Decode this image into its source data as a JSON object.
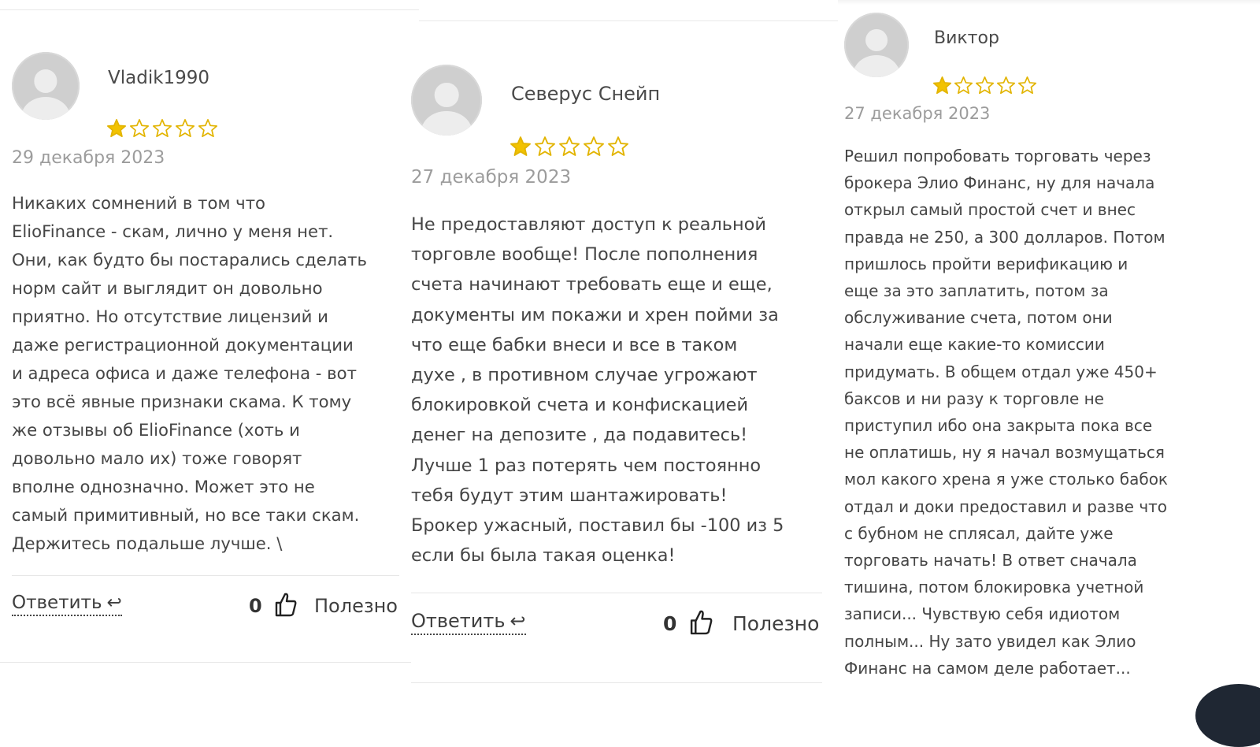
{
  "colors": {
    "star_filled": "#f2c200",
    "star_empty_stroke": "#e2b400",
    "date": "#9c9c9c",
    "text": "#454545"
  },
  "icons": {
    "avatar": "default-user-avatar",
    "star": "star-icon",
    "reply": "reply-arrow-icon",
    "like": "thumbs-up-icon"
  },
  "reviews": [
    {
      "author": "Vladik1990",
      "rating": 1,
      "max_rating": 5,
      "date": "29 декабря 2023",
      "lines": [
        "Никаких сомнений в том что",
        "ElioFinance - скам, лично у меня нет.",
        "Они, как будто бы постарались сделать",
        "норм сайт и выглядит он довольно",
        "приятно. Но отсутствие лицензий и",
        "даже регистрационной документации",
        "и адреса офиса и даже телефона - вот",
        "это всё явные признаки скама. К тому",
        "же отзывы об ElioFinance (хоть и",
        "довольно мало их) тоже говорят",
        "вполне однозначно. Может это не",
        "самый примитивный, но все таки скам.",
        "Держитесь подальше лучше. \\"
      ],
      "reply_label": "Ответить",
      "reply_arrow": "↩",
      "likes": "0",
      "useful_label": "Полезно"
    },
    {
      "author": "Северус Снейп",
      "rating": 1,
      "max_rating": 5,
      "date": "27 декабря 2023",
      "lines": [
        "Не предоставляют доступ к реальной",
        "торговле вообще! После пополнения",
        "счета начинают требовать еще и еще,",
        "документы им покажи и хрен пойми за",
        "что еще бабки внеси и все в таком",
        "духе , в противном случае угрожают",
        "блокировкой счета и конфискацией",
        "денег на депозите , да подавитесь!",
        "Лучше 1 раз потерять чем постоянно",
        "тебя будут этим шантажировать!",
        "Брокер ужасный, поставил бы -100 из 5",
        "если бы была такая оценка!"
      ],
      "reply_label": "Ответить",
      "reply_arrow": "↩",
      "likes": "0",
      "useful_label": "Полезно"
    },
    {
      "author": "Виктор",
      "rating": 1,
      "max_rating": 5,
      "date": "27 декабря 2023",
      "lines": [
        "Решил попробовать торговать через",
        "брокера Элио Финанс, ну для начала",
        "открыл самый простой счет и внес",
        "правда не 250, а 300 долларов. Потом",
        "пришлось пройти верификацию и",
        "еще за это заплатить, потом за",
        "обслуживание счета, потом они",
        "начали еще какие-то комиссии",
        "придумать. В общем отдал уже 450+",
        "баксов и ни разу к торговле не",
        "приступил ибо она закрыта пока все",
        "не оплатишь, ну я начал возмущаться",
        "мол какого хрена я уже столько бабок",
        "отдал и доки предоставил и разве что",
        "с бубном не сплясал, дайте уже",
        "торговать начать! В ответ сначала",
        "тишина, потом блокировка учетной",
        "записи... Чувствую себя идиотом",
        "полным... Ну зато увидел как Элио",
        "Финанс на самом деле работает..."
      ]
    }
  ]
}
